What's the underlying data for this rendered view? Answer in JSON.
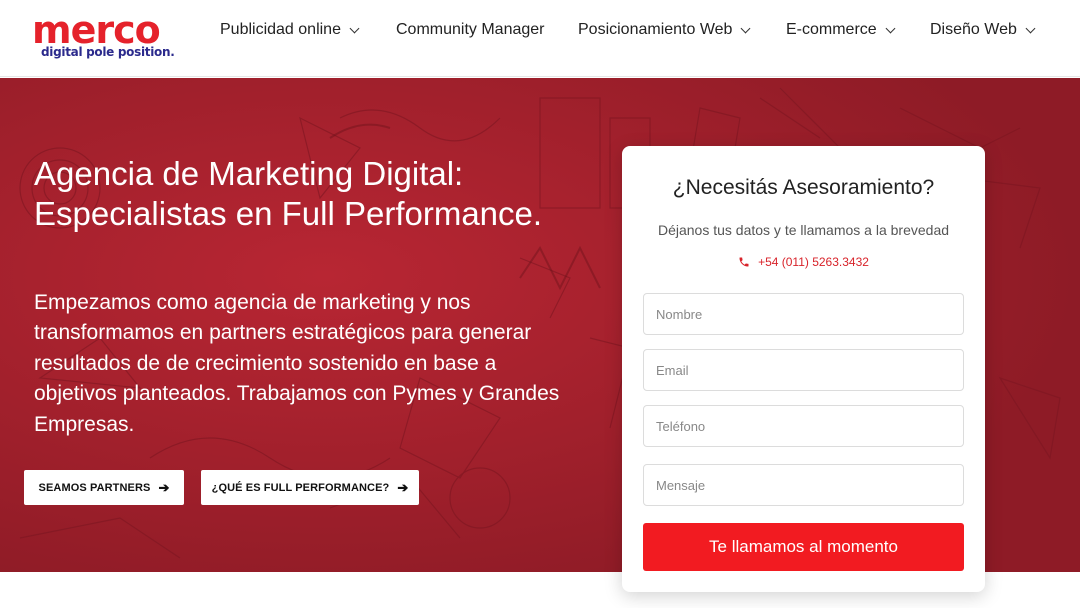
{
  "brand": {
    "name": "merco",
    "tagline": "digital pole position.",
    "name_color": "#e5222b",
    "tagline_color": "#2b2a8c"
  },
  "nav": {
    "items": [
      {
        "label": "Publicidad online",
        "has_dropdown": true
      },
      {
        "label": "Community Manager",
        "has_dropdown": false
      },
      {
        "label": "Posicionamiento Web",
        "has_dropdown": true
      },
      {
        "label": "E-commerce",
        "has_dropdown": true
      },
      {
        "label": "Diseño Web",
        "has_dropdown": true
      }
    ]
  },
  "hero": {
    "title": "Agencia de Marketing Digital: Especialistas en Full Performance.",
    "text": "Empezamos como agencia de marketing y nos transformamos en partners estratégicos para generar resultados de de crecimiento sostenido en base a objetivos planteados. Trabajamos con Pymes y Grandes Empresas.",
    "buttons": [
      {
        "label": "SEAMOS PARTNERS",
        "icon": "arrow-right-icon"
      },
      {
        "label": "¿QUÉ ES FULL PERFORMANCE?",
        "icon": "arrow-right-icon"
      }
    ],
    "background_color": "#a8222e"
  },
  "contact_form": {
    "title": "¿Necesitás Asesoramiento?",
    "subtitle": "Déjanos tus datos y te llamamos a la brevedad",
    "phone": "+54 (011) 5263.3432",
    "phone_icon": "phone-icon",
    "fields": [
      {
        "placeholder": "Nombre",
        "value": ""
      },
      {
        "placeholder": "Email",
        "value": ""
      },
      {
        "placeholder": "Teléfono",
        "value": ""
      },
      {
        "placeholder": "Mensaje",
        "value": ""
      }
    ],
    "submit_label": "Te llamamos al momento",
    "accent_color": "#f21b21"
  }
}
